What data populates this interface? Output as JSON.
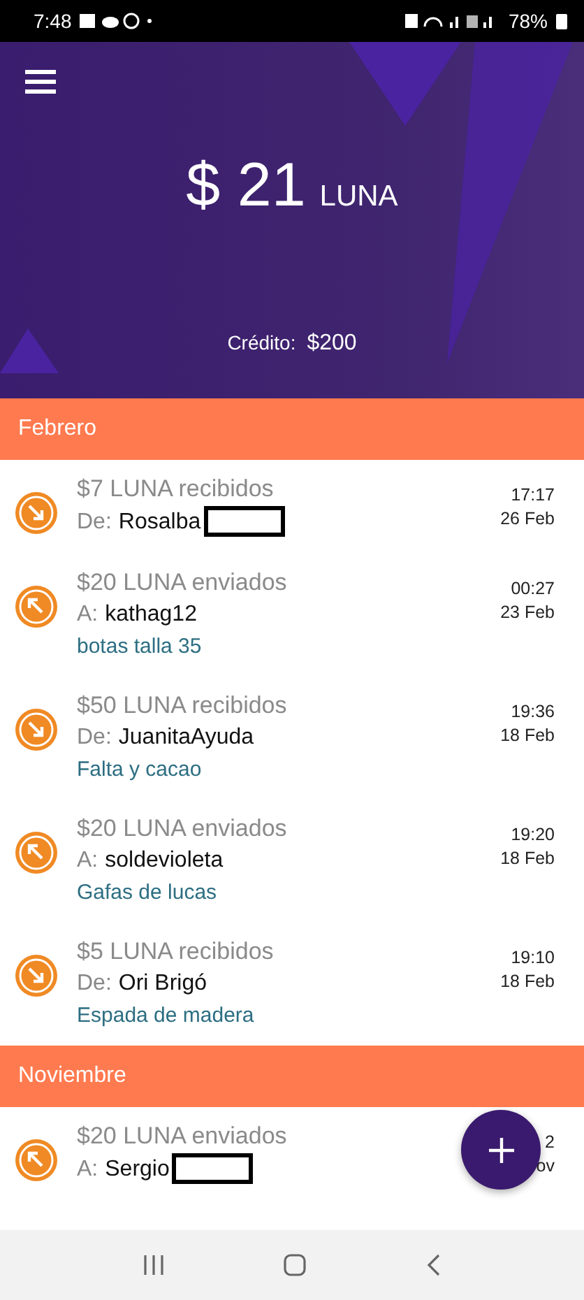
{
  "status_bar": {
    "time": "7:48",
    "battery": "78%"
  },
  "balance": {
    "currency_sign": "$",
    "amount": "21",
    "unit": "LUNA"
  },
  "credit": {
    "label": "Crédito:",
    "value": "$200"
  },
  "sections": [
    {
      "title": "Febrero",
      "transactions": [
        {
          "kind": "received",
          "title": "$7 LUNA recibidos",
          "prefix": "De:",
          "party": "Rosalba",
          "redacted": true,
          "time": "17:17",
          "date": "26 Feb"
        },
        {
          "kind": "sent",
          "title": "$20 LUNA enviados",
          "prefix": "A:",
          "party": "kathag12",
          "note": "botas talla 35",
          "time": "00:27",
          "date": "23 Feb"
        },
        {
          "kind": "received",
          "title": "$50 LUNA recibidos",
          "prefix": "De:",
          "party": "JuanitaAyuda",
          "note": "Falta y cacao",
          "time": "19:36",
          "date": "18 Feb"
        },
        {
          "kind": "sent",
          "title": "$20 LUNA enviados",
          "prefix": "A:",
          "party": "soldevioleta",
          "note": "Gafas de lucas",
          "time": "19:20",
          "date": "18 Feb"
        },
        {
          "kind": "received",
          "title": "$5 LUNA recibidos",
          "prefix": "De:",
          "party": "Ori Brigó",
          "note": "Espada de madera",
          "time": "19:10",
          "date": "18 Feb"
        }
      ]
    },
    {
      "title": "Noviembre",
      "transactions": [
        {
          "kind": "sent",
          "title": "$20 LUNA enviados",
          "prefix": "A:",
          "party": "Sergio",
          "redacted": true,
          "time": "2",
          "date": "ov"
        }
      ]
    }
  ]
}
